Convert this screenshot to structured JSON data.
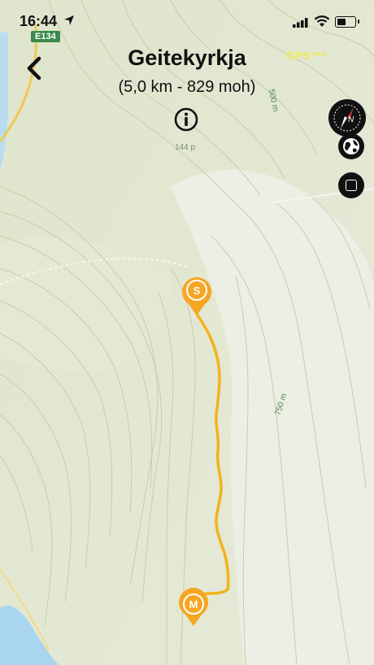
{
  "status_bar": {
    "time": "16:44",
    "route_badge": "E134"
  },
  "header": {
    "title": "Geitekyrkja",
    "subtitle": "(5,0 km - 829 moh)",
    "gps_label": "GPS",
    "gps_dots": "•••"
  },
  "map": {
    "contour_labels": [
      "500 m",
      "750 m"
    ],
    "spot_height": "144 p",
    "markers": {
      "start": "S",
      "end": "M"
    },
    "route_color": "#f5b21b",
    "water_color": "#a9d6ee"
  },
  "controls": {
    "compass_label": "N"
  }
}
